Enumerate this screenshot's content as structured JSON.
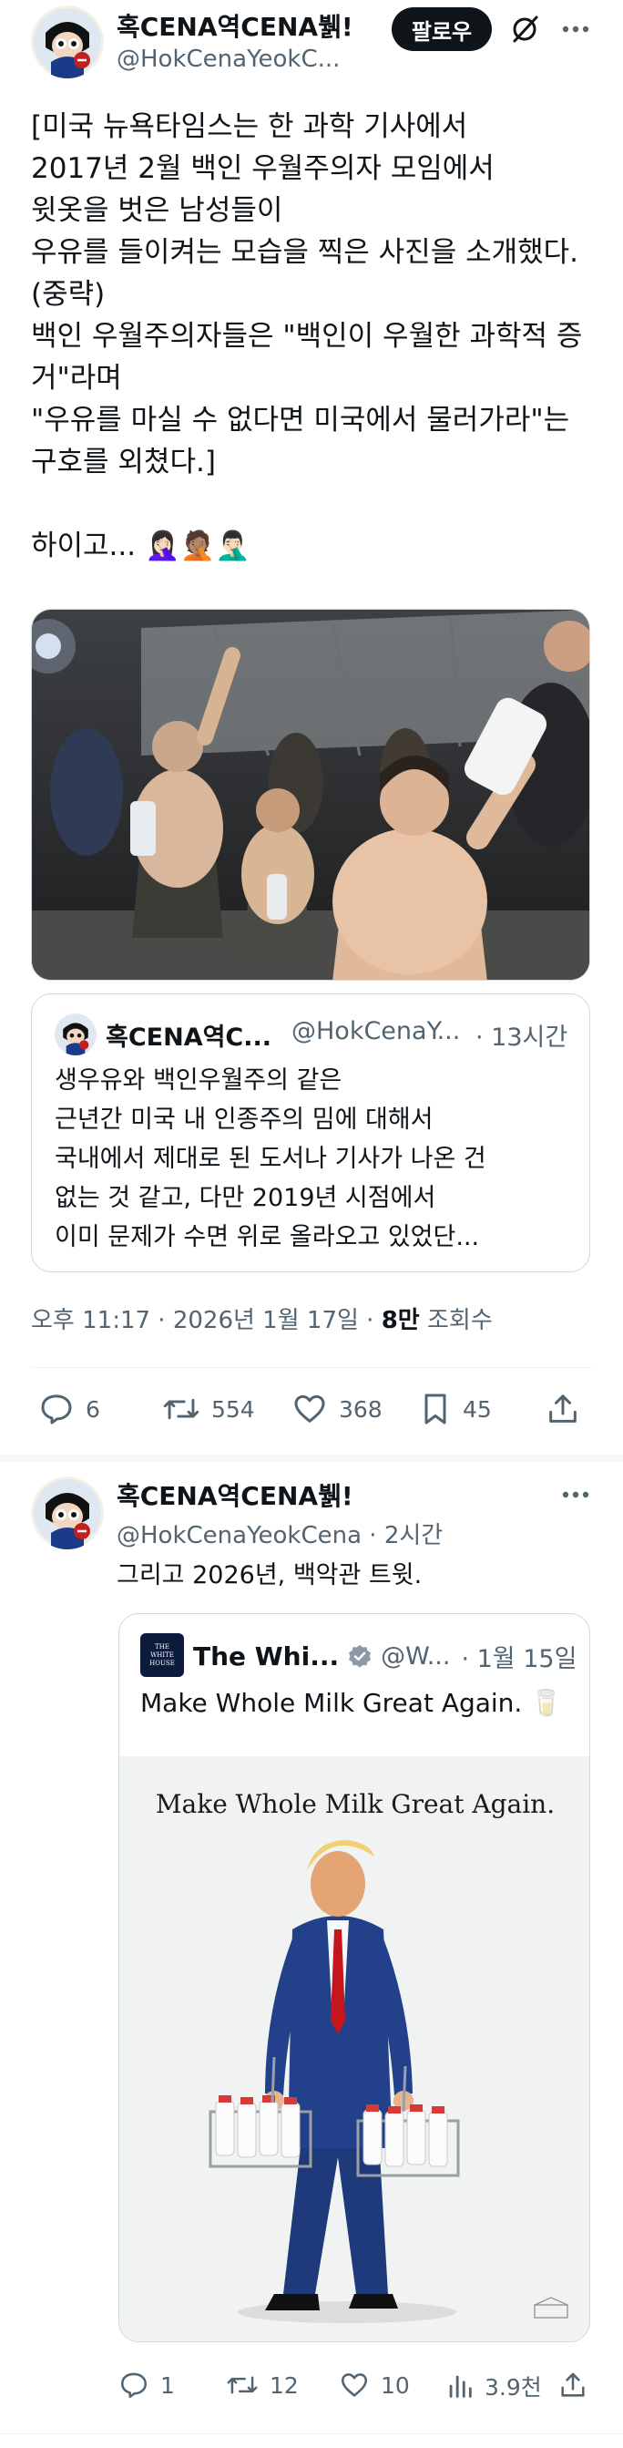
{
  "tweet": {
    "author_name": "혹CENA역CENA뷁!",
    "author_handle": "@HokCenaYeokC...",
    "follow_label": "팔로우",
    "body": "[미국 뉴욕타임스는 한 과학 기사에서\n2017년 2월 백인 우월주의자 모임에서\n윗옷을 벗은 남성들이\n우유를 들이켜는 모습을 찍은 사진을 소개했다.\n(중략)\n백인 우월주의자들은 \"백인이 우월한 과학적 증\n거\"라며\n\"우유를 마실 수 없다면 미국에서 물러가라\"는\n구호를 외쳤다.]\n\n하이고...",
    "emoji_suffix": "🤦🏻‍♀️🤦🏽🤦🏻‍♂️",
    "quote": {
      "author_name": "혹CENA역C...",
      "author_handle": "@HokCenaY...",
      "time": "· 13시간",
      "text": "생우유와 백인우월주의 같은\n근년간 미국 내 인종주의 밈에 대해서\n국내에서 제대로 된 도서나 기사가 나온 건\n없는 것 같고, 다만 2019년 시점에서\n이미 문제가 수면 위로 올라오고 있었단..."
    },
    "timestamp": "오후 11:17 · 2026년 1월 17일 · ",
    "views_count": "8만",
    "views_label": " 조회수",
    "actions": {
      "replies": "6",
      "reposts": "554",
      "likes": "368",
      "bookmarks": "45"
    }
  },
  "reply_tweet": {
    "author_name": "혹CENA역CENA뷁!",
    "author_handle": "@HokCenaYeokCena",
    "time": "· 2시간",
    "body": "그리고 2026년, 백악관 트윗.",
    "quote": {
      "author_name": "The Whi...",
      "author_handle": "@W...",
      "time": "· 1월 15일",
      "text": "Make Whole Milk Great Again. 🥛",
      "image_caption": "Make Whole Milk Great Again.",
      "logo_text": "THE WHITE HOUSE"
    },
    "actions": {
      "replies": "1",
      "reposts": "12",
      "likes": "10",
      "views": "3.9천"
    }
  },
  "colors": {
    "text": "#0f1419",
    "secondary": "#536471",
    "border": "#cfd9de",
    "verified_gold": "#e2b719"
  }
}
